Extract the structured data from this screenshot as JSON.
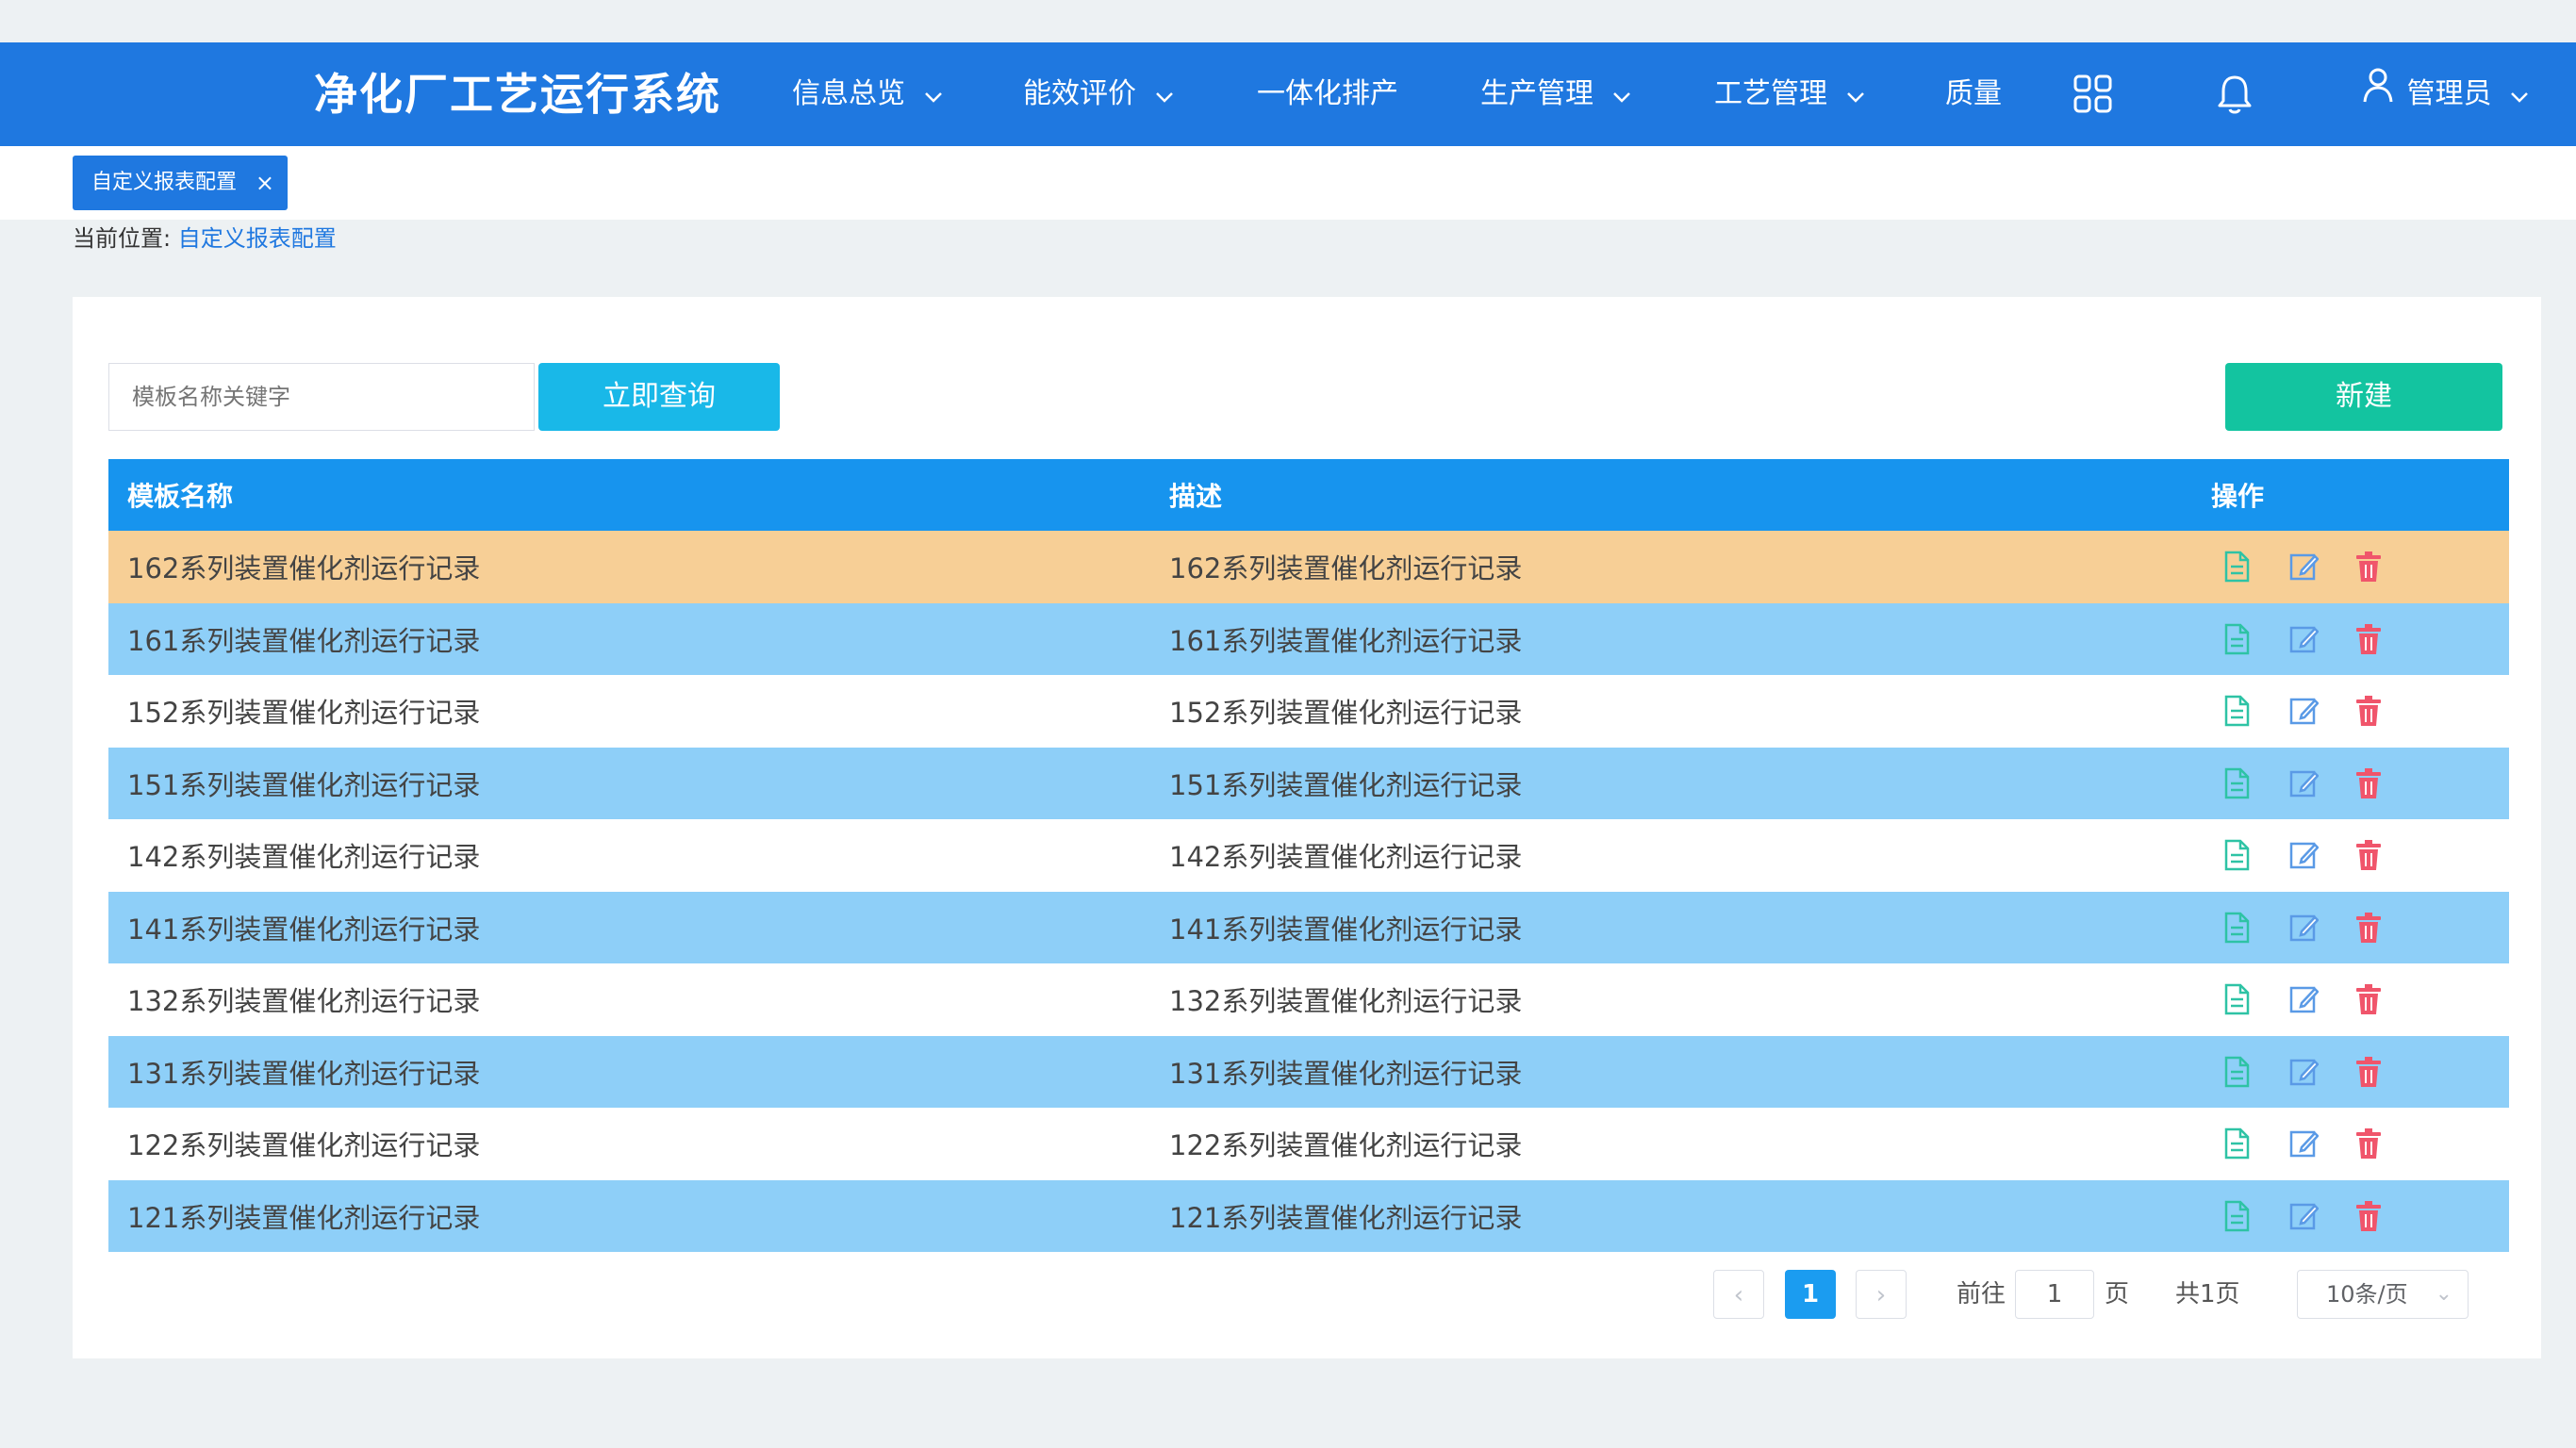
{
  "header": {
    "title": "净化厂工艺运行系统",
    "nav": [
      {
        "label": "信息总览",
        "has_dropdown": true
      },
      {
        "label": "能效评价",
        "has_dropdown": true
      },
      {
        "label": "一体化排产",
        "has_dropdown": false
      },
      {
        "label": "生产管理",
        "has_dropdown": true
      },
      {
        "label": "工艺管理",
        "has_dropdown": true
      },
      {
        "label": "质量",
        "has_dropdown": false
      }
    ],
    "user": "管理员",
    "icons": [
      "apps-grid-icon",
      "bell-icon",
      "user-icon"
    ],
    "color": "#1f78e0"
  },
  "tabs": [
    {
      "label": "自定义报表配置"
    }
  ],
  "breadcrumb": {
    "prefix": "当前位置:",
    "current": "自定义报表配置"
  },
  "toolbar": {
    "search_placeholder": "模板名称关键字",
    "search_value": "",
    "query_label": "立即查询",
    "new_label": "新建"
  },
  "table": {
    "columns": [
      "模板名称",
      "描述",
      "操作"
    ],
    "rows": [
      {
        "name": "162系列装置催化剂运行记录",
        "desc": "162系列装置催化剂运行记录",
        "state": "selected"
      },
      {
        "name": "161系列装置催化剂运行记录",
        "desc": "161系列装置催化剂运行记录",
        "state": "blue"
      },
      {
        "name": "152系列装置催化剂运行记录",
        "desc": "152系列装置催化剂运行记录",
        "state": "white"
      },
      {
        "name": "151系列装置催化剂运行记录",
        "desc": "151系列装置催化剂运行记录",
        "state": "blue"
      },
      {
        "name": "142系列装置催化剂运行记录",
        "desc": "142系列装置催化剂运行记录",
        "state": "white"
      },
      {
        "name": "141系列装置催化剂运行记录",
        "desc": "141系列装置催化剂运行记录",
        "state": "blue"
      },
      {
        "name": "132系列装置催化剂运行记录",
        "desc": "132系列装置催化剂运行记录",
        "state": "white"
      },
      {
        "name": "131系列装置催化剂运行记录",
        "desc": "131系列装置催化剂运行记录",
        "state": "blue"
      },
      {
        "name": "122系列装置催化剂运行记录",
        "desc": "122系列装置催化剂运行记录",
        "state": "white"
      },
      {
        "name": "121系列装置催化剂运行记录",
        "desc": "121系列装置催化剂运行记录",
        "state": "blue"
      }
    ],
    "row_actions": [
      "document-icon",
      "edit-icon",
      "trash-icon"
    ]
  },
  "pagination": {
    "current_page": "1",
    "goto_prefix": "前往",
    "goto_value": "1",
    "goto_suffix": "页",
    "total": "共1页",
    "page_size": "10条/页"
  },
  "colors": {
    "header_blue": "#1f78e0",
    "table_header": "#1794ee",
    "row_blue": "#8ecff8",
    "row_selected": "#f7cf96",
    "query_button": "#19b8e8",
    "new_button": "#13c4a0",
    "doc_icon": "#2ec3a5",
    "edit_icon": "#5a9ae6",
    "trash_icon": "#f0556b"
  }
}
